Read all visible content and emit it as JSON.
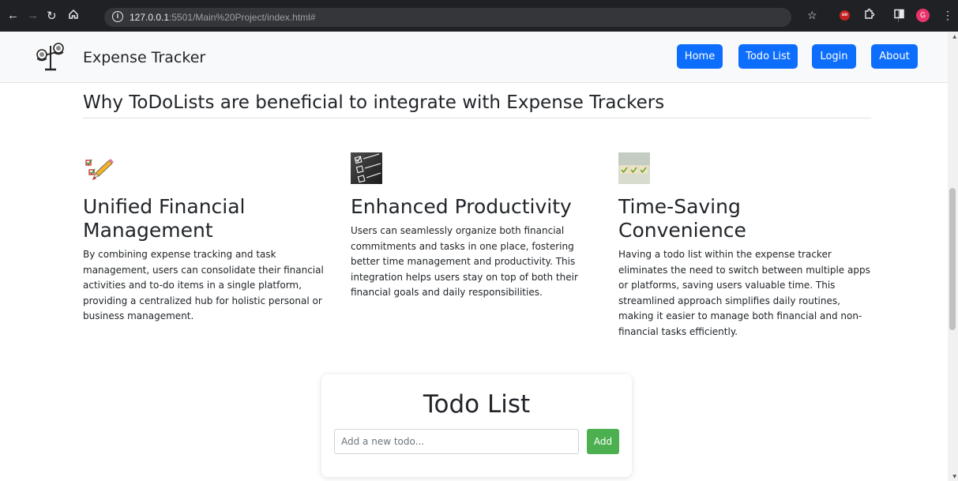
{
  "browser": {
    "url_host": "127.0.0.1",
    "url_path": ":5501/Main%20Project/index.html#",
    "info_glyph": "i",
    "extension_badge": "uo",
    "profile_initial": "G"
  },
  "navbar": {
    "brand": "Expense Tracker",
    "links": [
      "Home",
      "Todo List",
      "Login",
      "About"
    ]
  },
  "section": {
    "title": "Why ToDoLists are beneficial to integrate with Expense Trackers"
  },
  "features": [
    {
      "icon": "pencil-checklist-icon",
      "title": "Unified Financial Management",
      "text": "By combining expense tracking and task management, users can consolidate their financial activities and to-do items in a single platform, providing a centralized hub for holistic personal or business management."
    },
    {
      "icon": "checkbox-list-icon",
      "title": "Enhanced Productivity",
      "text": "Users can seamlessly organize both financial commitments and tasks in one place, fostering better time management and productivity. This integration helps users stay on top of both their financial goals and daily responsibilities."
    },
    {
      "icon": "checkmarks-icon",
      "title": "Time-Saving Convenience",
      "text": "Having a todo list within the expense tracker eliminates the need to switch between multiple apps or platforms, saving users valuable time. This streamlined approach simplifies daily routines, making it easier to manage both financial and non-financial tasks efficiently."
    }
  ],
  "todo": {
    "title": "Todo List",
    "placeholder": "Add a new todo...",
    "add_label": "Add"
  },
  "colors": {
    "primary": "#0d6efd",
    "add_button": "#4caf50",
    "navbar_bg": "#f8f9fa"
  }
}
